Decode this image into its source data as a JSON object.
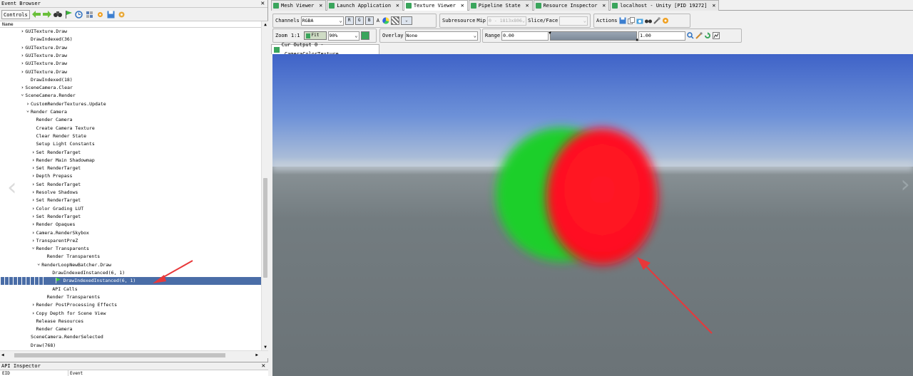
{
  "event_browser": {
    "title": "Event Browser",
    "close": "✕",
    "controls_label": "Controls",
    "column_header": "Name",
    "toolbar_icons": [
      "back-arrow-icon",
      "forward-arrow-icon",
      "binoculars-icon",
      "flag-icon",
      "timeline-icon",
      "options-icon",
      "save-icon",
      "settings-icon"
    ],
    "tree": [
      {
        "label": "GUITexture.Draw",
        "depth": 4,
        "arrow": "right"
      },
      {
        "label": "DrawIndexed(36)",
        "depth": 5,
        "arrow": ""
      },
      {
        "label": "GUITexture.Draw",
        "depth": 4,
        "arrow": "right"
      },
      {
        "label": "GUITexture.Draw",
        "depth": 4,
        "arrow": "right"
      },
      {
        "label": "GUITexture.Draw",
        "depth": 4,
        "arrow": "right"
      },
      {
        "label": "GUITexture.Draw",
        "depth": 4,
        "arrow": "right"
      },
      {
        "label": "DrawIndexed(18)",
        "depth": 5,
        "arrow": ""
      },
      {
        "label": "SceneCamera.Clear",
        "depth": 4,
        "arrow": "right"
      },
      {
        "label": "SceneCamera.Render",
        "depth": 4,
        "arrow": "down"
      },
      {
        "label": "CustomRenderTextures.Update",
        "depth": 5,
        "arrow": "right"
      },
      {
        "label": "Render Camera",
        "depth": 5,
        "arrow": "down"
      },
      {
        "label": "Render Camera",
        "depth": 6,
        "arrow": ""
      },
      {
        "label": "Create Camera Texture",
        "depth": 6,
        "arrow": ""
      },
      {
        "label": "Clear Render State",
        "depth": 6,
        "arrow": ""
      },
      {
        "label": "Setup Light Constants",
        "depth": 6,
        "arrow": ""
      },
      {
        "label": "Set RenderTarget",
        "depth": 6,
        "arrow": "right"
      },
      {
        "label": "Render Main Shadowmap",
        "depth": 6,
        "arrow": "right"
      },
      {
        "label": "Set RenderTarget",
        "depth": 6,
        "arrow": "right"
      },
      {
        "label": "Depth Prepass",
        "depth": 6,
        "arrow": "right"
      },
      {
        "label": "Set RenderTarget",
        "depth": 6,
        "arrow": "right"
      },
      {
        "label": "Resolve Shadows",
        "depth": 6,
        "arrow": "right"
      },
      {
        "label": "Set RenderTarget",
        "depth": 6,
        "arrow": "right"
      },
      {
        "label": "Color Grading LUT",
        "depth": 6,
        "arrow": "right"
      },
      {
        "label": "Set RenderTarget",
        "depth": 6,
        "arrow": "right"
      },
      {
        "label": "Render Opaques",
        "depth": 6,
        "arrow": "right"
      },
      {
        "label": "Camera.RenderSkybox",
        "depth": 6,
        "arrow": "right"
      },
      {
        "label": "TransparentPreZ",
        "depth": 6,
        "arrow": "right"
      },
      {
        "label": "Render Transparents",
        "depth": 6,
        "arrow": "down"
      },
      {
        "label": "Render Transparents",
        "depth": 8,
        "arrow": ""
      },
      {
        "label": "RenderLoopNewBatcher.Draw",
        "depth": 7,
        "arrow": "down"
      },
      {
        "label": "DrawIndexedInstanced(6, 1)",
        "depth": 9,
        "arrow": ""
      },
      {
        "label": "DrawIndexedInstanced(6, 1)",
        "depth": 11,
        "arrow": "",
        "selected": true,
        "flag": true
      },
      {
        "label": "API Calls",
        "depth": 9,
        "arrow": ""
      },
      {
        "label": "Render Transparents",
        "depth": 8,
        "arrow": ""
      },
      {
        "label": "Render PostProcessing Effects",
        "depth": 6,
        "arrow": "right"
      },
      {
        "label": "Copy Depth for Scene View",
        "depth": 6,
        "arrow": "right"
      },
      {
        "label": "Release Resources",
        "depth": 6,
        "arrow": ""
      },
      {
        "label": "Render Camera",
        "depth": 6,
        "arrow": ""
      },
      {
        "label": "SceneCamera.RenderSelected",
        "depth": 5,
        "arrow": ""
      },
      {
        "label": "Draw(768)",
        "depth": 5,
        "arrow": ""
      }
    ]
  },
  "api_inspector": {
    "title": "API Inspector",
    "close": "✕",
    "col1": "EID",
    "col2": "Event"
  },
  "tabs": [
    {
      "label": "Mesh Viewer",
      "close": "✕"
    },
    {
      "label": "Launch Application",
      "close": "✕"
    },
    {
      "label": "Texture Viewer",
      "close": "✕",
      "active": true
    },
    {
      "label": "Pipeline State",
      "close": "✕"
    },
    {
      "label": "Resource Inspector",
      "close": "✕"
    },
    {
      "label": "localhost - Unity [PID 19272]",
      "close": "✕"
    }
  ],
  "toolbar": {
    "channels_label": "Channels",
    "channels_value": "RGBA",
    "channel_r": "R",
    "channel_g": "G",
    "channel_b": "B",
    "channel_a": "A",
    "subresource_label": "Subresource",
    "mip_label": "Mip",
    "mip_value": "0 - 1813x806",
    "slice_label": "Slice/Face",
    "slice_value": "",
    "actions_label": "Actions",
    "zoom_label": "Zoom",
    "zoom_1to1": "1:1",
    "fit_label": "Fit",
    "zoom_value": "90%",
    "overlay_label": "Overlay",
    "overlay_value": "None",
    "range_label": "Range",
    "range_min": "0.00",
    "range_max": "1.00"
  },
  "output_tab": "Cur Output 0 - _CameraColorTexture",
  "colors": {
    "selection": "#4a6da7",
    "sky_top": "#3e64c9",
    "sky_horizon": "#b7c6d8",
    "ground": "#6f777b",
    "sphere_green": "#1ecc2a",
    "sphere_red": "#ff1222",
    "annotation_arrow": "#e8383a"
  }
}
